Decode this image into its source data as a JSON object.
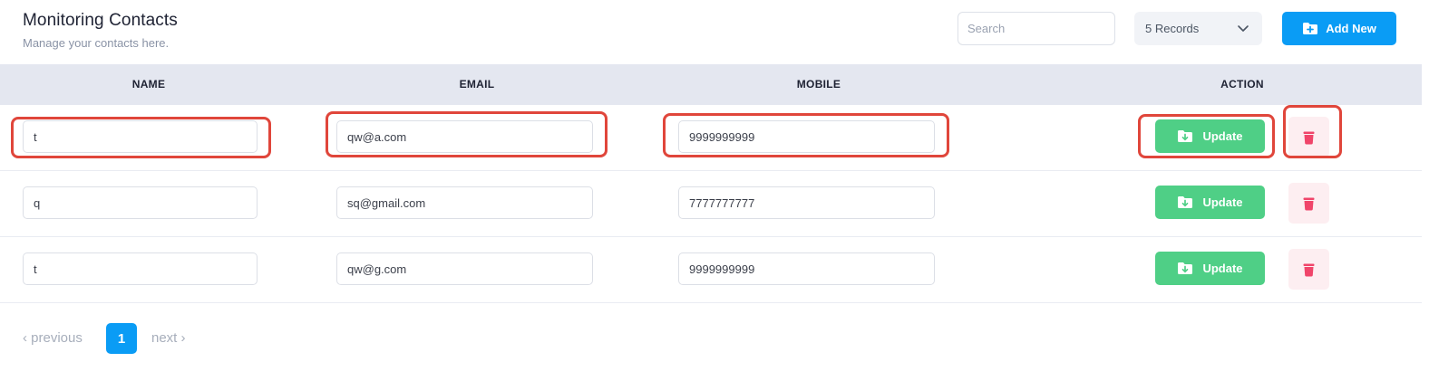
{
  "header": {
    "title": "Monitoring Contacts",
    "subtitle": "Manage your contacts here.",
    "search_placeholder": "Search",
    "records_label": "5 Records",
    "add_new_label": "Add New"
  },
  "table": {
    "columns": [
      "NAME",
      "EMAIL",
      "MOBILE",
      "ACTION"
    ],
    "rows": [
      {
        "name": "t",
        "email": "qw@a.com",
        "mobile": "9999999999",
        "update_label": "Update"
      },
      {
        "name": "q",
        "email": "sq@gmail.com",
        "mobile": "7777777777",
        "update_label": "Update"
      },
      {
        "name": "t",
        "email": "qw@g.com",
        "mobile": "9999999999",
        "update_label": "Update"
      }
    ]
  },
  "pagination": {
    "previous_label": "previous",
    "current_page": "1",
    "next_label": "next"
  },
  "icons": {
    "dropdown": "chevron-down-icon",
    "add": "folder-plus-icon",
    "update": "folder-download-icon",
    "delete": "trash-icon"
  },
  "colors": {
    "primary": "#0a9cf5",
    "update": "#4fcf86",
    "delete": "#f0456a",
    "delete_bg": "#fdeef1",
    "header_bg": "#e4e7f0",
    "highlight": "#e0463b"
  }
}
